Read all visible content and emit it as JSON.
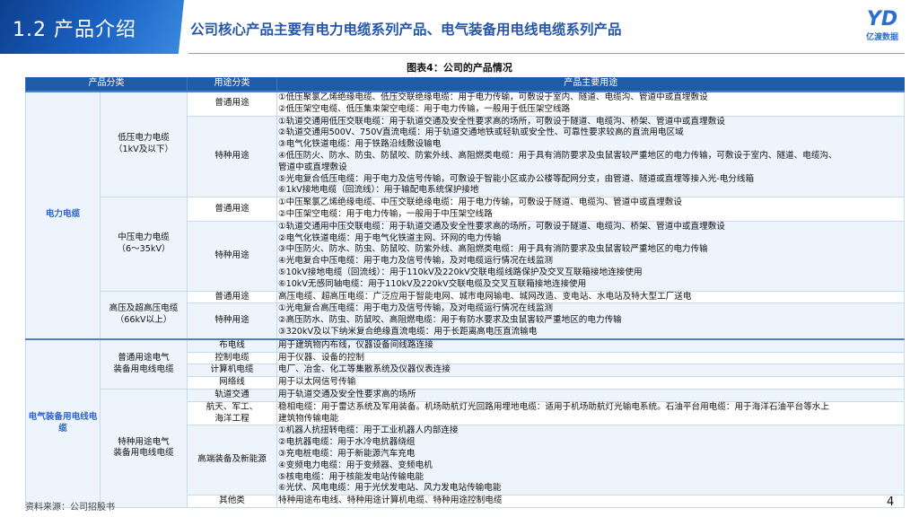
{
  "header": {
    "section": "1.2 产品介绍",
    "title": "公司核心产品主要有电力电缆系列产品、电气装备用电线电缆系列产品",
    "logo_text": "亿渡数据",
    "logo_mark": "YD"
  },
  "caption": "图表4：公司的产品情况",
  "table": {
    "headers": [
      "产品分类",
      "用途分类",
      "产品主要用途"
    ],
    "groups": [
      {
        "category": "电力电缆",
        "subgroups": [
          {
            "name": [
              "低压电力电缆",
              "（1kV及以下）"
            ],
            "rows": [
              {
                "use": [
                  "普通用途"
                ],
                "lines": [
                  "①低压聚氯乙烯绝缘电缆、低压交联绝缘电缆：用于电力传输，可敷设于室内、隧道、电缆沟、管道中或直埋敷设",
                  "②低压架空电缆、低压集束架空电缆：用于电力传输，一般用于低压架空线路"
                ]
              },
              {
                "use": [
                  "特种用途"
                ],
                "lines": [
                  "①轨道交通用低压交联电缆：用于轨道交通及安全性要求高的场所，可敷设于隧道、电缆沟、桥架、管道中或直埋敷设",
                  "②轨道交通用500V、750V直流电缆：用于轨道交通地铁或轻轨或安全性、可靠性要求较高的直流用电区域",
                  "③电气化铁道电缆：用于铁路沿线敷设输电",
                  "④低压防火、防水、防虫、防鼠咬、防紫外线、高阻燃类电缆：用于具有消防要求及虫鼠害较严重地区的电力传输，可敷设于室内、隧道、电缆沟、",
                  "管道中或直埋敷设",
                  "⑤光电复合低压电缆：用于电力及信号传输，可敷设于智能小区或办公楼等配网分支，由管道、隧道或直埋等接入光-电分线箱",
                  "⑥1kV接地电缆（回流线）：用于输配电系统保护接地"
                ]
              }
            ]
          },
          {
            "name": [
              "中压电力电缆",
              "（6～35kV）"
            ],
            "rows": [
              {
                "use": [
                  "普通用途"
                ],
                "lines": [
                  "①中压聚氯乙烯绝缘电缆、中压交联绝缘电缆：用于电力传输，可敷设于隧道、电缆沟、管道中或直埋敷设",
                  "②中压架空电缆：用于电力传输，一般用于中压架空线路"
                ]
              },
              {
                "use": [
                  "特种用途"
                ],
                "lines": [
                  "①轨道交通用中压交联电缆：用于轨道交通及安全性要求高的场所，可敷设于隧道、电缆沟、桥架、管道中或直埋敷设",
                  "②电气化铁道电缆：用于电气化铁道主网、环网的电力传输",
                  "③中压防火、防水、防虫、防鼠咬、防紫外线、高阻燃类电缆：用于具有消防要求及虫鼠害较严重地区的电力传输",
                  "④光电复合中压电缆：用于电力及信号传输，及对电缆运行情况在线监测",
                  "⑤10kV接地电缆（回流线）：用于110kV及220kV交联电缆线路保护及交叉互联箱接地连接使用",
                  "⑥10kV无感同轴电缆：用于110kV及220kV交联电缆及交叉互联箱接地连接使用"
                ]
              }
            ]
          },
          {
            "name": [
              "高压及超高压电缆",
              "（66kV以上）"
            ],
            "rows": [
              {
                "use": [
                  "普通用途"
                ],
                "lines": [
                  "高压电缆、超高压电缆：广泛应用于智能电网、城市电网输电、城网改造、变电站、水电站及特大型工厂送电"
                ]
              },
              {
                "use": [
                  "特种用途"
                ],
                "lines": [
                  "①光电复合高压电缆：用于电力及信号传输，及对电缆运行情况在线监测",
                  "②高压防水、防虫、防鼠咬、高阻燃电缆：用于有防水要求及虫鼠害较严重地区的电力传输",
                  "③320kV及以下纳米复合绝缘直流电缆：用于长距离高电压直流输电"
                ]
              }
            ]
          }
        ]
      },
      {
        "category": "电气装备用电线电缆",
        "subgroups": [
          {
            "name": [
              "普通用途电气",
              "装备用电线电缆"
            ],
            "rows": [
              {
                "use": [
                  "布电线"
                ],
                "lines": [
                  "用于建筑物内布线，仪器设备间线路连接"
                ]
              },
              {
                "use": [
                  "控制电缆"
                ],
                "lines": [
                  "用于仪器、设备的控制"
                ]
              },
              {
                "use": [
                  "计算机电缆"
                ],
                "lines": [
                  "电厂、冶金、化工等集散系统及仪器仪表连接"
                ]
              },
              {
                "use": [
                  "网络线"
                ],
                "lines": [
                  "用于以太网信号传输"
                ]
              }
            ]
          },
          {
            "name": [
              "特种用途电气",
              "装备用电线电缆"
            ],
            "rows": [
              {
                "use": [
                  "轨道交通"
                ],
                "lines": [
                  "用于轨道交通及安全性要求高的场所"
                ]
              },
              {
                "use": [
                  "航天、军工、",
                  "海洋工程"
                ],
                "lines": [
                  "稳相电缆：用于雷达系统及军用装备。机场助航灯光回路用埋地电缆：适用于机场助航灯光输电系统。石油平台用电缆：用于海洋石油平台等水上",
                  "建筑物传输电能"
                ]
              },
              {
                "use": [
                  "高端装备及新能源"
                ],
                "lines": [
                  "①机器人抗扭转电缆：用于工业机器人内部连接",
                  "②电抗器电缆：用于水冷电抗器绕组",
                  "③充电桩电缆：用于新能源汽车充电",
                  "④变频电力电缆：用于变频器、变频电机",
                  "⑤核电电缆：用于核能发电站传输电能",
                  "⑥光伏、风电电缆：用于光伏发电站、风力发电站传输电能"
                ]
              },
              {
                "use": [
                  "其他类"
                ],
                "lines": [
                  "特种用途布电线、特种用途计算机电缆、特种用途控制电缆"
                ]
              }
            ]
          }
        ]
      }
    ]
  },
  "footer": {
    "source": "资料来源：公司招股书",
    "page": "4"
  }
}
